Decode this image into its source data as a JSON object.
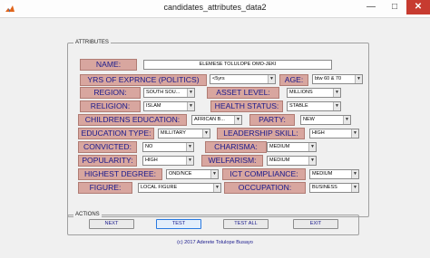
{
  "window": {
    "title": "candidates_attributes_data2"
  },
  "groups": {
    "attributes": "ATTRIBUTES",
    "actions": "ACTIONS"
  },
  "labels": {
    "name": "NAME:",
    "yrs": "YRS OF EXPRNCE (POLITICS)",
    "age": "AGE:",
    "region": "REGION:",
    "asset": "ASSET LEVEL:",
    "religion": "RELIGION:",
    "health": "HEALTH STATUS:",
    "children_edu": "CHILDRENS EDUCATION:",
    "party": "PARTY:",
    "edu_type": "EDUCATION TYPE:",
    "leadership": "LEADERSHIP SKILL:",
    "convicted": "CONVICTED:",
    "charisma": "CHARISMA:",
    "popularity": "POPULARITY:",
    "welfarism": "WELFARISM:",
    "highest_degree": "HIGHEST DEGREE:",
    "ict": "ICT COMPLIANCE:",
    "figure": "FIGURE:",
    "occupation": "OCCUPATION:"
  },
  "values": {
    "name": "ELEMESE TOLULOPE OMO-JEKI",
    "yrs": "<5yrs",
    "age": "btw 60 & 70",
    "region": "SOUTH SOU...",
    "asset": "MILLIONS",
    "religion": "ISLAM",
    "health": "STABLE",
    "children_edu": "AFRICAN B...",
    "party": "NEW",
    "edu_type": "MILLITARY",
    "leadership": "HIGH",
    "convicted": "NO",
    "charisma": "MEDIUM",
    "popularity": "HIGH",
    "welfarism": "MEDIUM",
    "highest_degree": "OND/NCE",
    "ict": "MEDIUM",
    "figure": "LOCAL FIGURE",
    "occupation": "BUSINESS"
  },
  "buttons": {
    "next": "NEXT",
    "test": "TEST",
    "test_all": "TEST ALL",
    "exit": "EXIT"
  },
  "footer": {
    "copyright": "(c) 2017 Aderete Tolulope Busayo"
  }
}
